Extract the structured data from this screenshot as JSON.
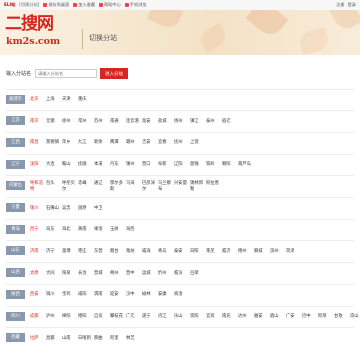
{
  "topbar": {
    "city": "ELI站",
    "switch": "[切换分站]",
    "links": [
      "保存到桌面",
      "加入收藏",
      "帮助中心",
      "手机浏览"
    ],
    "login": "注册",
    "register": "登录"
  },
  "logo": {
    "title": "二搜网",
    "domain": "km2s.com"
  },
  "page_title": "切换分站",
  "search": {
    "label": "输入分站名",
    "placeholder": "请输入分站名",
    "button": "进入分站"
  },
  "provinces": [
    {
      "name": "直辖市",
      "cities": [
        "北京",
        "上海",
        "天津",
        "重庆"
      ]
    },
    {
      "name": "江苏",
      "cities": [
        "南京",
        "无锡",
        "徐州",
        "常州",
        "苏州",
        "南通",
        "连云港",
        "淮安",
        "盐城",
        "扬州",
        "镇江",
        "泰州",
        "宿迁"
      ]
    },
    {
      "name": "江西",
      "cities": [
        "南昌",
        "景德镇",
        "萍乡",
        "九江",
        "新余",
        "鹰潭",
        "赣州",
        "吉安",
        "宜春",
        "抚州",
        "上饶"
      ]
    },
    {
      "name": "辽宁",
      "cities": [
        "沈阳",
        "大连",
        "鞍山",
        "抚顺",
        "本溪",
        "丹东",
        "锦州",
        "营口",
        "阜新",
        "辽阳",
        "盘锦",
        "铁岭",
        "朝阳",
        "葫芦岛"
      ]
    },
    {
      "name": "内蒙古",
      "cities": [
        "呼和浩特",
        "包头",
        "呼伦贝尔",
        "赤峰",
        "通辽",
        "鄂尔多斯",
        "乌海",
        "巴彦淖尔",
        "乌兰察布",
        "兴安盟",
        "锡林郭勒",
        "阿拉善"
      ]
    },
    {
      "name": "宁夏",
      "cities": [
        "银川",
        "石嘴山",
        "吴忠",
        "固原",
        "中卫"
      ]
    },
    {
      "name": "青海",
      "cities": [
        "西宁",
        "海东",
        "海北",
        "黄南",
        "果洛",
        "玉树",
        "海西"
      ]
    },
    {
      "name": "山东",
      "cities": [
        "济南",
        "济宁",
        "淄博",
        "枣庄",
        "东营",
        "烟台",
        "潍坊",
        "威海",
        "青岛",
        "泰安",
        "日照",
        "莱芜",
        "临沂",
        "德州",
        "聊城",
        "滨州",
        "菏泽"
      ]
    },
    {
      "name": "山西",
      "cities": [
        "太原",
        "大同",
        "阳泉",
        "长治",
        "晋城",
        "朔州",
        "晋中",
        "运城",
        "忻州",
        "临汾",
        "吕梁"
      ]
    },
    {
      "name": "陕西",
      "cities": [
        "西安",
        "铜川",
        "宝鸡",
        "咸阳",
        "渭南",
        "延安",
        "汉中",
        "榆林",
        "安康",
        "商洛"
      ]
    },
    {
      "name": "四川",
      "cities": [
        "成都",
        "泸州",
        "绵阳",
        "德阳",
        "自贡",
        "攀枝花",
        "广元",
        "遂宁",
        "内江",
        "乐山",
        "资阳",
        "宜宾",
        "南充",
        "达州",
        "雅安",
        "眉山",
        "广安",
        "巴中",
        "阿坝",
        "甘孜",
        "凉山"
      ]
    },
    {
      "name": "西藏",
      "cities": [
        "拉萨",
        "昌都",
        "山南",
        "日喀则",
        "那曲",
        "阿里",
        "林芝"
      ]
    }
  ]
}
